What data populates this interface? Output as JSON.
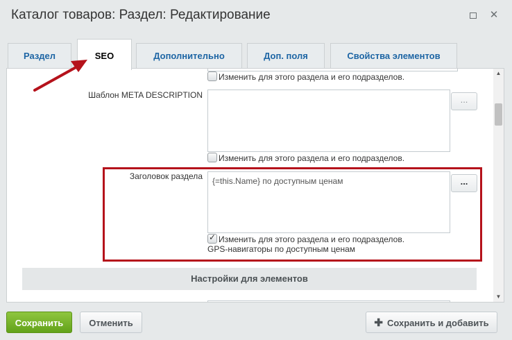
{
  "window": {
    "title": "Каталог товаров: Раздел: Редактирование",
    "maximize_icon": "maximize-icon",
    "close_icon": "close-icon",
    "close_glyph": "✕"
  },
  "tabs": [
    {
      "label": "Раздел",
      "active": false
    },
    {
      "label": "SEO",
      "active": true
    },
    {
      "label": "Дополнительно",
      "active": false
    },
    {
      "label": "Доп. поля",
      "active": false
    },
    {
      "label": "Свойства элементов",
      "active": false
    }
  ],
  "form": {
    "top_checkbox_label": "Изменить для этого раздела и его подразделов.",
    "meta_description": {
      "label": "Шаблон META DESCRIPTION",
      "value": "",
      "button": "...",
      "checkbox_label": "Изменить для этого раздела и его подразделов.",
      "checked": false
    },
    "section_heading": {
      "label": "Заголовок раздела",
      "value": "{=this.Name} по доступным ценам",
      "button": "...",
      "checkbox_label": "Изменить для этого раздела и его подразделов.",
      "checked": true,
      "preview": "GPS-навигаторы по доступным ценам"
    },
    "elements_section_title": "Настройки для элементов"
  },
  "footer": {
    "save": "Сохранить",
    "cancel": "Отменить",
    "save_and_add": "Сохранить и добавить",
    "save_and_add_icon": "plus-icon"
  },
  "colors": {
    "annotation": "#b5121b",
    "save_button": "#70ad24",
    "tab_link": "#1d65a4"
  }
}
